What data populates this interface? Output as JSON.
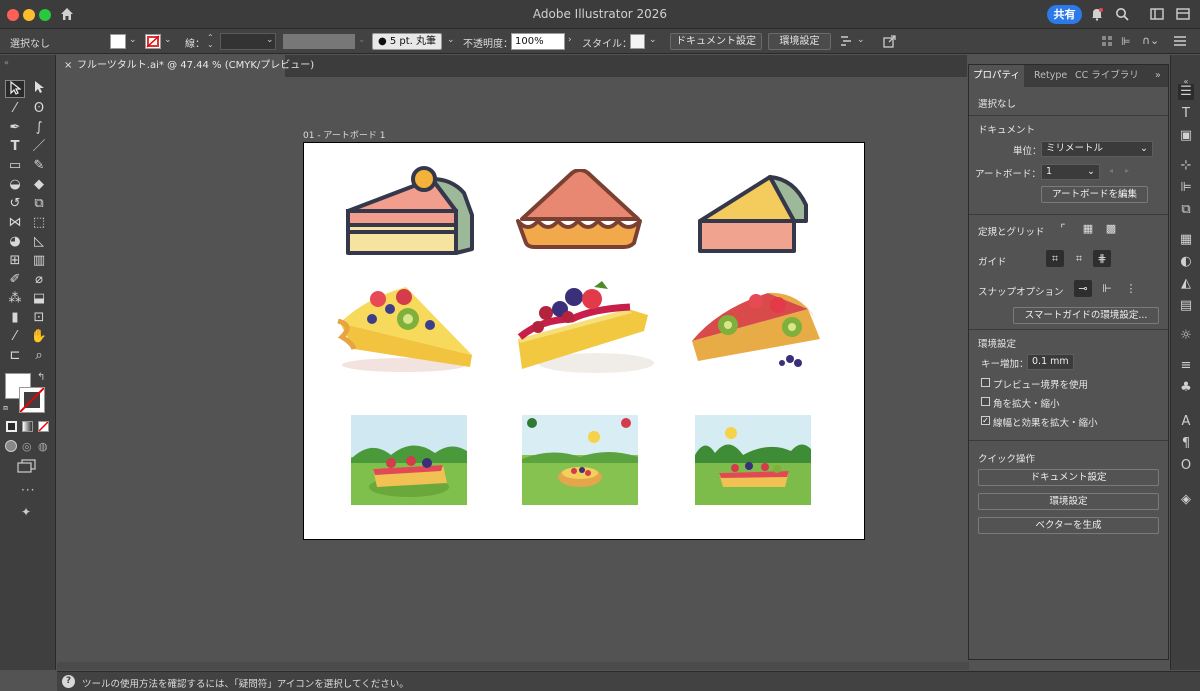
{
  "window": {
    "title": "Adobe Illustrator 2026",
    "share_label": "共有"
  },
  "controlbar": {
    "selection": "選択なし",
    "stroke_label": "線：",
    "brush_label": "5 pt. 丸筆",
    "opacity_label": "不透明度：",
    "opacity_value": "100%",
    "style_label": "スタイル：",
    "doc_settings": "ドキュメント設定",
    "preferences": "環境設定"
  },
  "document": {
    "tab_title": "フルーツタルト.ai* @ 47.44 % (CMYK/プレビュー)",
    "close_glyph": "×"
  },
  "artboard": {
    "label": "01 - アートボード 1"
  },
  "panel": {
    "tabs": [
      "プロパティ",
      "Retype",
      "CC ライブラリ"
    ],
    "selection": "選択なし",
    "document_header": "ドキュメント",
    "units_label": "単位：",
    "units_value": "ミリメートル",
    "artboard_label": "アートボード：",
    "artboard_value": "1",
    "edit_artboard": "アートボードを編集",
    "rulers_grid": "定規とグリッド",
    "guides": "ガイド",
    "snap_options": "スナップオプション",
    "smart_guides": "スマートガイドの環境設定...",
    "preferences_header": "環境設定",
    "key_increment_label": "キー増加：",
    "key_increment_value": "0.1 mm",
    "checkboxes": [
      {
        "label": "プレビュー境界を使用",
        "checked": false
      },
      {
        "label": "角を拡大・縮小",
        "checked": false
      },
      {
        "label": "線幅と効果を拡大・縮小",
        "checked": true
      }
    ],
    "quick_actions": "クイック操作",
    "qa_buttons": [
      "ドキュメント設定",
      "環境設定",
      "ベクターを生成"
    ]
  },
  "status": {
    "hint": "ツールの使用方法を確認するには、「疑問符」アイコンを選択してください。"
  },
  "colors": {
    "accent": "#2c7ae9",
    "traffic_red": "#fe5f57",
    "traffic_yellow": "#febc2e",
    "traffic_green": "#28c840"
  }
}
